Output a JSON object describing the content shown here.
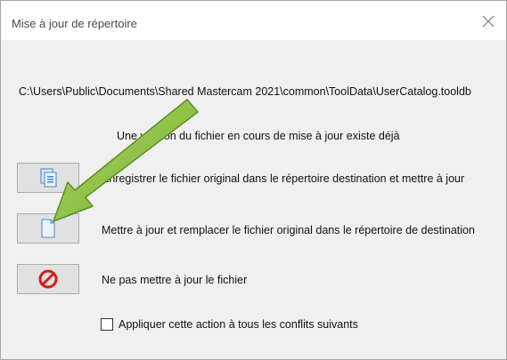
{
  "window": {
    "title": "Mise à jour de répertoire",
    "close_icon": "close-icon"
  },
  "dialog": {
    "file_path": "C:\\Users\\Public\\Documents\\Shared Mastercam 2021\\common\\ToolData\\UserCatalog.tooldb",
    "message": "Une version du fichier en cours de mise à jour existe déjà",
    "options": [
      {
        "icon": "copy-files-icon",
        "label": "Enregistrer le fichier original dans le répertoire destination et mettre à jour"
      },
      {
        "icon": "new-document-icon",
        "label": "Mettre à jour et remplacer le fichier original dans le répertoire de destination"
      },
      {
        "icon": "prohibited-icon",
        "label": "Ne pas mettre à jour le fichier"
      }
    ],
    "apply_all": {
      "label": "Appliquer cette action à tous les conflits suivants",
      "checked": false
    }
  },
  "annotation": {
    "icon": "green-arrow-icon",
    "color": "#8cc63f"
  }
}
